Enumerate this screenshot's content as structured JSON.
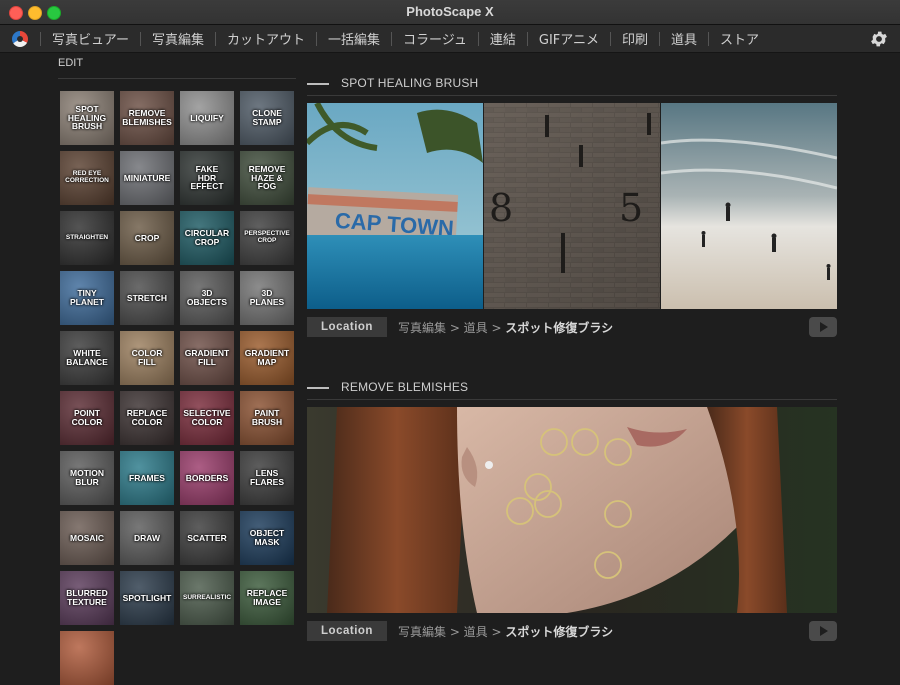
{
  "window": {
    "title": "PhotoScape X"
  },
  "menu": {
    "items": [
      {
        "label": "写真ビュアー"
      },
      {
        "label": "写真編集"
      },
      {
        "label": "カットアウト"
      },
      {
        "label": "一括編集"
      },
      {
        "label": "コラージュ"
      },
      {
        "label": "連結"
      },
      {
        "label": "GIFアニメ"
      },
      {
        "label": "印刷"
      },
      {
        "label": "道具"
      },
      {
        "label": "ストア"
      }
    ]
  },
  "sidebar": {
    "heading": "EDIT",
    "tools": [
      {
        "label": "SPOT\nHEALING\nBRUSH",
        "bg": "#8b7f74"
      },
      {
        "label": "REMOVE\nBLEMISHES",
        "bg": "#6b4e43"
      },
      {
        "label": "LIQUIFY",
        "bg": "#8f8f8f"
      },
      {
        "label": "CLONE\nSTAMP",
        "bg": "#4e5a66"
      },
      {
        "label": "RED EYE\nCORRECTION",
        "bg": "#5a4030",
        "small": true
      },
      {
        "label": "MINIATURE",
        "bg": "#6c6e73"
      },
      {
        "label": "FAKE\nHDR EFFECT",
        "bg": "#2d3331"
      },
      {
        "label": "REMOVE\nHAZE & FOG",
        "bg": "#3e4c3a"
      },
      {
        "label": "STRAIGHTEN",
        "bg": "#2e2e2e",
        "small": true
      },
      {
        "label": "CROP",
        "bg": "#6b5a45"
      },
      {
        "label": "CIRCULAR\nCROP",
        "bg": "#1c5a63"
      },
      {
        "label": "PERSPECTIVE\nCROP",
        "bg": "#3d3d3d",
        "small": true
      },
      {
        "label": "TINY\nPLANET",
        "bg": "#3c6a9a"
      },
      {
        "label": "STRETCH",
        "bg": "#4a4a4a"
      },
      {
        "label": "3D\nOBJECTS",
        "bg": "#595959"
      },
      {
        "label": "3D\nPLANES",
        "bg": "#737373"
      },
      {
        "label": "WHITE\nBALANCE",
        "bg": "#3a3a3a"
      },
      {
        "label": "COLOR\nFILL",
        "bg": "#9c7f5e"
      },
      {
        "label": "GRADIENT\nFILL",
        "bg": "#6e4e46"
      },
      {
        "label": "GRADIENT\nMAP",
        "bg": "#9a5a2a"
      },
      {
        "label": "POINT\nCOLOR",
        "bg": "#5a2a32"
      },
      {
        "label": "REPLACE\nCOLOR",
        "bg": "#3a3030"
      },
      {
        "label": "SELECTIVE\nCOLOR",
        "bg": "#7a2a3a"
      },
      {
        "label": "PAINT\nBRUSH",
        "bg": "#8a5030"
      },
      {
        "label": "MOTION\nBLUR",
        "bg": "#5a5a5a"
      },
      {
        "label": "FRAMES",
        "bg": "#2a7a8a"
      },
      {
        "label": "BORDERS",
        "bg": "#9a3a6a"
      },
      {
        "label": "LENS\nFLARES",
        "bg": "#3a3a3a"
      },
      {
        "label": "MOSAIC",
        "bg": "#6a5a52"
      },
      {
        "label": "DRAW",
        "bg": "#5a5a5a"
      },
      {
        "label": "SCATTER",
        "bg": "#3a3a3a"
      },
      {
        "label": "OBJECT\nMASK",
        "bg": "#1a3a5a"
      },
      {
        "label": "BLURRED\nTEXTURE",
        "bg": "#5a3a5a"
      },
      {
        "label": "SPOTLIGHT",
        "bg": "#2a3a4a"
      },
      {
        "label": "SURREALISTIC",
        "bg": "#4a5a4a",
        "small": true
      },
      {
        "label": "REPLACE\nIMAGE",
        "bg": "#3a5a3a"
      },
      {
        "label": "",
        "bg": "#b05a3a"
      }
    ]
  },
  "sections": [
    {
      "title": "SPOT HEALING BRUSH",
      "location_label": "Location",
      "path_prefix": "写真編集 > 道具 > ",
      "path_tool": "スポット修復ブラシ"
    },
    {
      "title": "REMOVE BLEMISHES",
      "location_label": "Location",
      "path_prefix": "写真編集 > 道具 > ",
      "path_tool": "スポット修復ブラシ"
    }
  ],
  "photo1": {
    "sign_text": "CAP TOWN",
    "wall_numbers": [
      "8",
      "5"
    ]
  },
  "colors": {
    "background": "#1e1e1e",
    "menubar": "#2b2b2b",
    "accent_circle": "#d6c27a"
  },
  "icons": {
    "settings": "gear-icon",
    "play": "play-icon",
    "logo": "photoscape-logo-icon"
  }
}
